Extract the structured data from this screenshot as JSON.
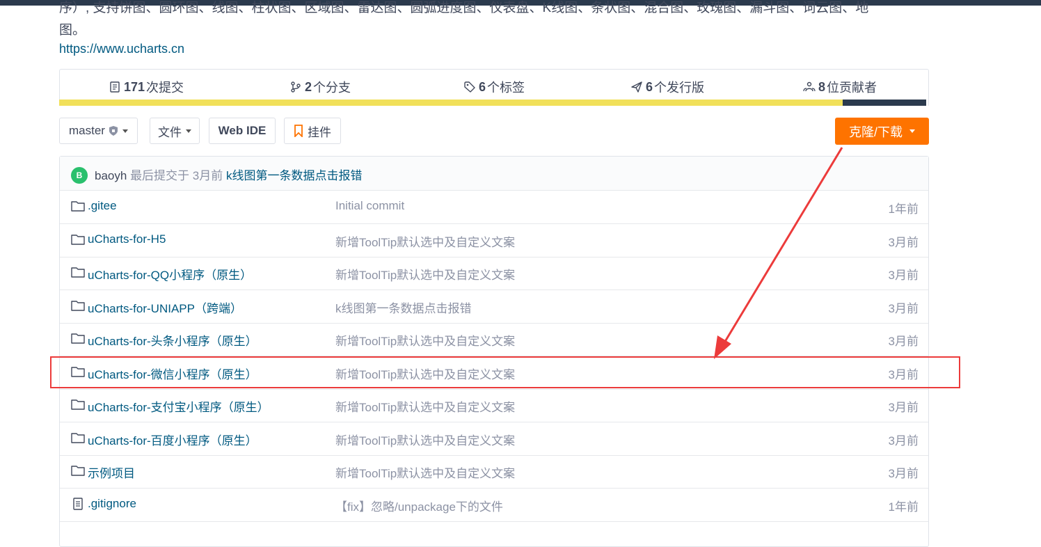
{
  "description": {
    "line1": "序）, 支持饼图、圆环图、线图、柱状图、区域图、雷达图、圆弧进度图、仪表盘、K线图、条状图、混合图、玫瑰图、漏斗图、词云图、地",
    "line2": "图。",
    "link": "https://www.ucharts.cn"
  },
  "stats": [
    {
      "icon": "commit-icon",
      "count": "171",
      "label": "次提交"
    },
    {
      "icon": "branch-icon",
      "count": "2",
      "label": "个分支"
    },
    {
      "icon": "tag-icon",
      "count": "6",
      "label": "个标签"
    },
    {
      "icon": "release-icon",
      "count": "6",
      "label": "个发行版"
    },
    {
      "icon": "contributors-icon",
      "count": "8",
      "label": "位贡献者"
    }
  ],
  "language_bar": {
    "colors": [
      "#f1e05a",
      "#2b3a4d"
    ]
  },
  "toolbar": {
    "branch": "master",
    "files": "文件",
    "web_ide": "Web IDE",
    "widget": "挂件",
    "clone": "克隆/下载"
  },
  "last_commit": {
    "avatar_letter": "B",
    "author": "baoyh",
    "meta": "最后提交于 3月前",
    "message": "k线图第一条数据点击报错"
  },
  "files": [
    {
      "type": "folder",
      "name": ".gitee",
      "message": "Initial commit",
      "time": "1年前"
    },
    {
      "type": "folder",
      "name": "uCharts-for-H5",
      "message": "新增ToolTip默认选中及自定义文案",
      "time": "3月前"
    },
    {
      "type": "folder",
      "name": "uCharts-for-QQ小程序（原生）",
      "message": "新增ToolTip默认选中及自定义文案",
      "time": "3月前"
    },
    {
      "type": "folder",
      "name": "uCharts-for-UNIAPP（跨端）",
      "message": "k线图第一条数据点击报错",
      "time": "3月前"
    },
    {
      "type": "folder",
      "name": "uCharts-for-头条小程序（原生）",
      "message": "新增ToolTip默认选中及自定义文案",
      "time": "3月前"
    },
    {
      "type": "folder",
      "name": "uCharts-for-微信小程序（原生）",
      "message": "新增ToolTip默认选中及自定义文案",
      "time": "3月前"
    },
    {
      "type": "folder",
      "name": "uCharts-for-支付宝小程序（原生）",
      "message": "新增ToolTip默认选中及自定义文案",
      "time": "3月前"
    },
    {
      "type": "folder",
      "name": "uCharts-for-百度小程序（原生）",
      "message": "新增ToolTip默认选中及自定义文案",
      "time": "3月前"
    },
    {
      "type": "folder",
      "name": "示例项目",
      "message": "新增ToolTip默认选中及自定义文案",
      "time": "3月前"
    },
    {
      "type": "file",
      "name": ".gitignore",
      "message": "【fix】忽略/unpackage下的文件",
      "time": "1年前"
    }
  ],
  "annotation": {
    "color": "#ec3b3b",
    "highlighted_row": "uCharts-for-微信小程序（原生）"
  }
}
